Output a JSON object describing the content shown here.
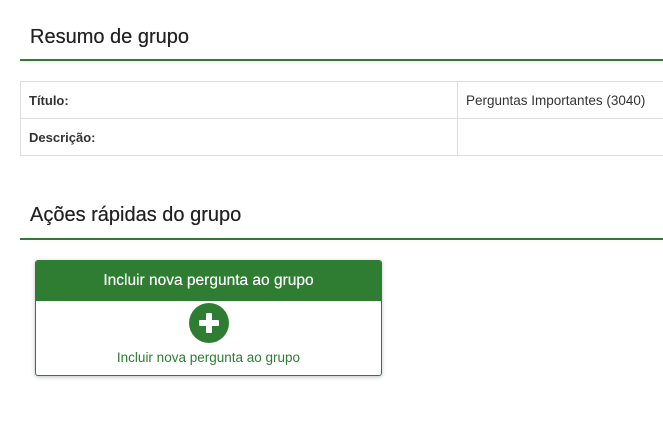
{
  "summary": {
    "heading": "Resumo de grupo",
    "rows": [
      {
        "label": "Título:",
        "value": "Perguntas Importantes (3040)"
      },
      {
        "label": "Descrição:",
        "value": ""
      }
    ]
  },
  "actions": {
    "heading": "Ações rápidas do grupo",
    "card": {
      "title": "Incluir nova pergunta ao grupo",
      "icon": "plus-circle-icon",
      "caption": "Incluir nova pergunta ao grupo"
    }
  },
  "colors": {
    "accent": "#2e7d32",
    "border": "#dddddd"
  }
}
